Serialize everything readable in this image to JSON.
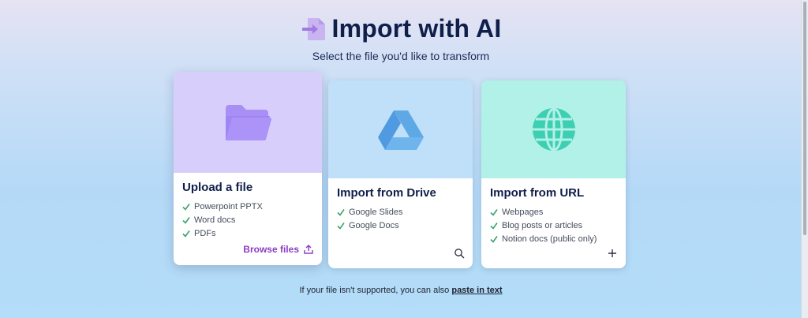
{
  "header": {
    "title": "Import with AI",
    "subtitle": "Select the file you'd like to transform",
    "icon": "file-import-icon"
  },
  "cards": [
    {
      "title": "Upload a file",
      "icon": "folder-icon",
      "top_color": "#d8cefc",
      "features": [
        "Powerpoint PPTX",
        "Word docs",
        "PDFs"
      ],
      "action_label": "Browse files",
      "action_icon": "upload-icon"
    },
    {
      "title": "Import from Drive",
      "icon": "google-drive-icon",
      "top_color": "#bfe0f8",
      "features": [
        "Google Slides",
        "Google Docs"
      ],
      "action_icon": "search-icon"
    },
    {
      "title": "Import from URL",
      "icon": "globe-icon",
      "top_color": "#b2f1e7",
      "features": [
        "Webpages",
        "Blog posts or articles",
        "Notion docs (public only)"
      ],
      "action_icon": "plus-icon"
    }
  ],
  "footer": {
    "text": "If your file isn't supported, you can also",
    "link": "paste in text"
  },
  "colors": {
    "accent_purple": "#8b3cc4",
    "check_green": "#3aa46a",
    "title_navy": "#0f1f4a"
  }
}
